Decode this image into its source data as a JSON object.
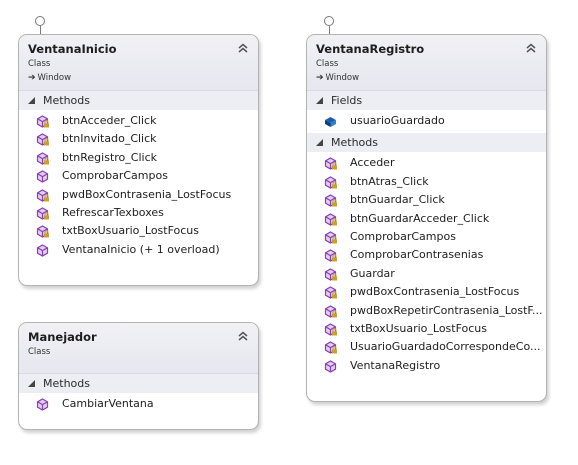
{
  "classes": {
    "ventana_inicio": {
      "name": "VentanaInicio",
      "stereotype": "Class",
      "base": "Window",
      "methods_label": "Methods",
      "methods": [
        {
          "label": "btnAcceder_Click",
          "icon": "private-method-icon"
        },
        {
          "label": "btnInvitado_Click",
          "icon": "private-method-icon"
        },
        {
          "label": "btnRegistro_Click",
          "icon": "private-method-icon"
        },
        {
          "label": "ComprobarCampos",
          "icon": "public-method-icon"
        },
        {
          "label": "pwdBoxContrasenia_LostFocus",
          "icon": "private-method-icon"
        },
        {
          "label": "RefrescarTexboxes",
          "icon": "private-method-icon"
        },
        {
          "label": "txtBoxUsuario_LostFocus",
          "icon": "private-method-icon"
        },
        {
          "label": "VentanaInicio (+ 1 overload)",
          "icon": "public-method-icon"
        }
      ]
    },
    "ventana_registro": {
      "name": "VentanaRegistro",
      "stereotype": "Class",
      "base": "Window",
      "fields_label": "Fields",
      "fields": [
        {
          "label": "usuarioGuardado",
          "icon": "field-icon"
        }
      ],
      "methods_label": "Methods",
      "methods": [
        {
          "label": "Acceder",
          "icon": "private-method-icon"
        },
        {
          "label": "btnAtras_Click",
          "icon": "private-method-icon"
        },
        {
          "label": "btnGuardar_Click",
          "icon": "private-method-icon"
        },
        {
          "label": "btnGuardarAcceder_Click",
          "icon": "private-method-icon"
        },
        {
          "label": "ComprobarCampos",
          "icon": "private-method-icon"
        },
        {
          "label": "ComprobarContrasenias",
          "icon": "private-method-icon"
        },
        {
          "label": "Guardar",
          "icon": "private-method-icon"
        },
        {
          "label": "pwdBoxContrasenia_LostFocus",
          "icon": "private-method-icon"
        },
        {
          "label": "pwdBoxRepetirContrasenia_LostF...",
          "icon": "private-method-icon"
        },
        {
          "label": "txtBoxUsuario_LostFocus",
          "icon": "private-method-icon"
        },
        {
          "label": "UsuarioGuardadoCorrespondeCo...",
          "icon": "private-method-icon"
        },
        {
          "label": "VentanaRegistro",
          "icon": "public-method-icon"
        }
      ]
    },
    "manejador": {
      "name": "Manejador",
      "stereotype": "Class",
      "methods_label": "Methods",
      "methods": [
        {
          "label": "CambiarVentana",
          "icon": "public-method-icon"
        }
      ]
    }
  },
  "colors": {
    "method_icon": "#8a3fb5",
    "field_icon": "#1c5fa8",
    "lock_overlay": "#c8a030"
  }
}
